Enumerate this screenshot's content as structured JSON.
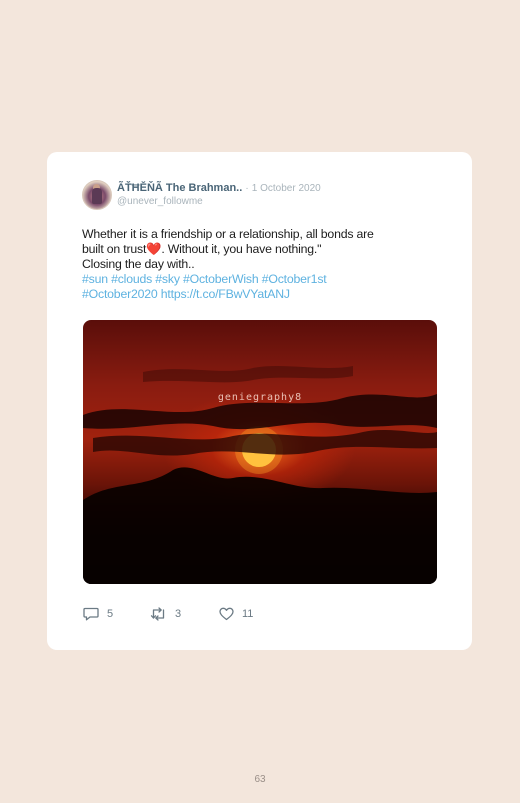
{
  "tweet": {
    "display_name": "ÃŤĦĔŇÃ The Brahman..",
    "date_separator": "·",
    "date": "1 October 2020",
    "handle": "@unever_followme",
    "text_line1": "Whether it is a friendship or a relationship, all bonds are",
    "text_line2_a": "built on trust",
    "text_line2_emoji": "❤️",
    "text_line2_b": ". Without it, you have nothing.\"",
    "text_line3": "Closing the day with..",
    "hashtags_line1": "#sun #clouds #sky #OctoberWish #October1st",
    "hashtags_line2": "#October2020 https://t.co/FBwVYatANJ",
    "photo_watermark": "geniegraphy8",
    "reply_count": "5",
    "retweet_count": "3",
    "like_count": "11"
  },
  "page": {
    "number": "63"
  },
  "colors": {
    "background": "#f3e6dc",
    "card": "#ffffff",
    "link": "#5eb2e0",
    "name": "#4a6577"
  },
  "icons": {
    "reply": "reply-icon",
    "retweet": "retweet-icon",
    "like": "heart-icon"
  }
}
